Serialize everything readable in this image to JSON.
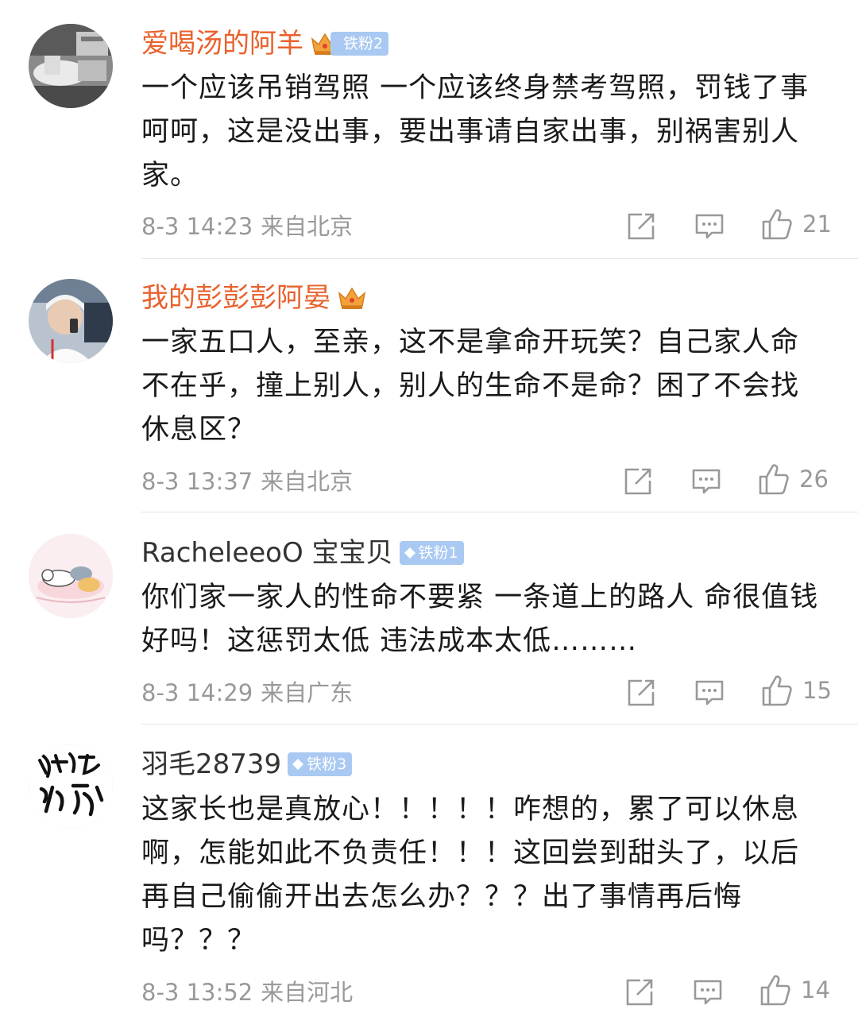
{
  "comments": [
    {
      "username": "爱喝汤的阿羊",
      "vip": true,
      "fan_badge": "铁粉2",
      "text": "一个应该吊销驾照 一个应该终身禁考驾照，罚钱了事呵呵，这是没出事，要出事请自家出事，别祸害别人家。",
      "time": "8-3 14:23",
      "location": "来自北京",
      "likes": "21",
      "avatar_icon": "avatar-grayscale-photo"
    },
    {
      "username": "我的彭彭彭阿晏",
      "vip": true,
      "fan_badge": "",
      "text": "一家五口人，至亲，这不是拿命开玩笑？自己家人命不在乎，撞上别人，别人的生命不是命？困了不会找休息区？",
      "time": "8-3 13:37",
      "location": "来自北京",
      "likes": "26",
      "avatar_icon": "avatar-person-on-phone"
    },
    {
      "username": "RacheleeoO 宝宝贝",
      "vip": false,
      "fan_badge": "铁粉1",
      "text": "你们家一家人的性命不要紧 一条道上的路人 命很值钱好吗！这惩罚太低 违法成本太低………",
      "time": "8-3 14:29",
      "location": "来自广东",
      "likes": "15",
      "avatar_icon": "avatar-sleeping-cats"
    },
    {
      "username": "羽毛28739",
      "vip": false,
      "fan_badge": "铁粉3",
      "text": "这家长也是真放心！！！！！咋想的，累了可以休息啊，怎能如此不负责任！！！这回尝到甜头了，以后再自己偷偷开出去怎么办？？？出了事情再后悔吗？？？",
      "time": "8-3 13:52",
      "location": "来自河北",
      "likes": "14",
      "avatar_icon": "avatar-calligraphy"
    }
  ],
  "colors": {
    "vip_name": "#e8612c",
    "normal_name": "#333333",
    "meta": "#999999",
    "badge_bg": "#a9c9f2"
  },
  "icons": {
    "share": "share-icon",
    "comment": "comment-icon",
    "like": "like-icon",
    "crown": "crown-icon",
    "diamond": "diamond-icon"
  }
}
